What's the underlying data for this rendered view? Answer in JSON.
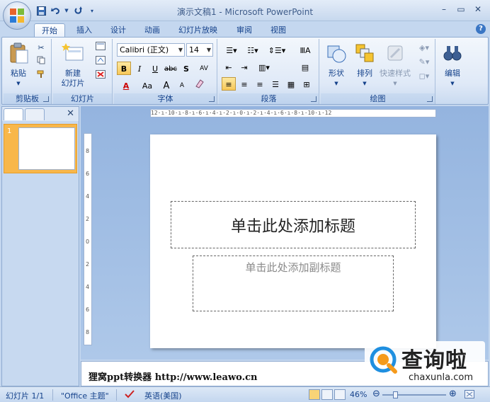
{
  "window": {
    "title": "演示文稿1 - Microsoft PowerPoint",
    "minimize": "–",
    "restore": "▭",
    "close": "✕"
  },
  "qat": {
    "save_icon": "save-icon",
    "undo_icon": "undo-icon",
    "redo_icon": "redo-icon",
    "customize_icon": "customize-icon"
  },
  "tabs": [
    "开始",
    "插入",
    "设计",
    "动画",
    "幻灯片放映",
    "审阅",
    "视图"
  ],
  "help_label": "?",
  "ribbon": {
    "clipboard": {
      "label": "剪贴板",
      "paste": "粘贴"
    },
    "slides": {
      "label": "幻灯片",
      "new_slide_line1": "新建",
      "new_slide_line2": "幻灯片"
    },
    "font": {
      "label": "字体",
      "font_name": "Calibri (正文)",
      "font_size": "14",
      "bold": "B",
      "italic": "I",
      "underline": "U",
      "strike": "abc",
      "shadow": "S",
      "spacing": "AV",
      "color": "A",
      "case": "Aa",
      "grow": "A",
      "shrink": "A"
    },
    "paragraph": {
      "label": "段落"
    },
    "drawing": {
      "label": "绘图",
      "shapes": "形状",
      "arrange": "排列",
      "quick_styles": "快速样式"
    },
    "editing": {
      "label": "编辑"
    }
  },
  "left_panel": {
    "slide_number": "1",
    "close": "✕"
  },
  "ruler": {
    "horizontal": "12·ı·10·ı·8·ı·6·ı·4·ı·2·ı·0·ı·2·ı·4·ı·6·ı·8·ı·10·ı·12",
    "vertical": [
      "8",
      "6",
      "4",
      "2",
      "0",
      "2",
      "4",
      "6",
      "8"
    ]
  },
  "slide": {
    "title_placeholder": "单击此处添加标题",
    "subtitle_placeholder": "单击此处添加副标题"
  },
  "notes": {
    "text": "狸窝ppt转换器   http://www.leawo.cn"
  },
  "watermark": {
    "brand_cn": "查询啦",
    "brand_en": "chaxunla.com"
  },
  "status": {
    "slide_counter": "幻灯片 1/1",
    "theme": "\"Office 主题\"",
    "language": "英语(美国)",
    "zoom": "46%",
    "zoom_fraction": 0.46
  },
  "colors": {
    "accent": "#15428b",
    "ribbon_bg": "#dfe9f7",
    "selection": "#f8b74a"
  }
}
